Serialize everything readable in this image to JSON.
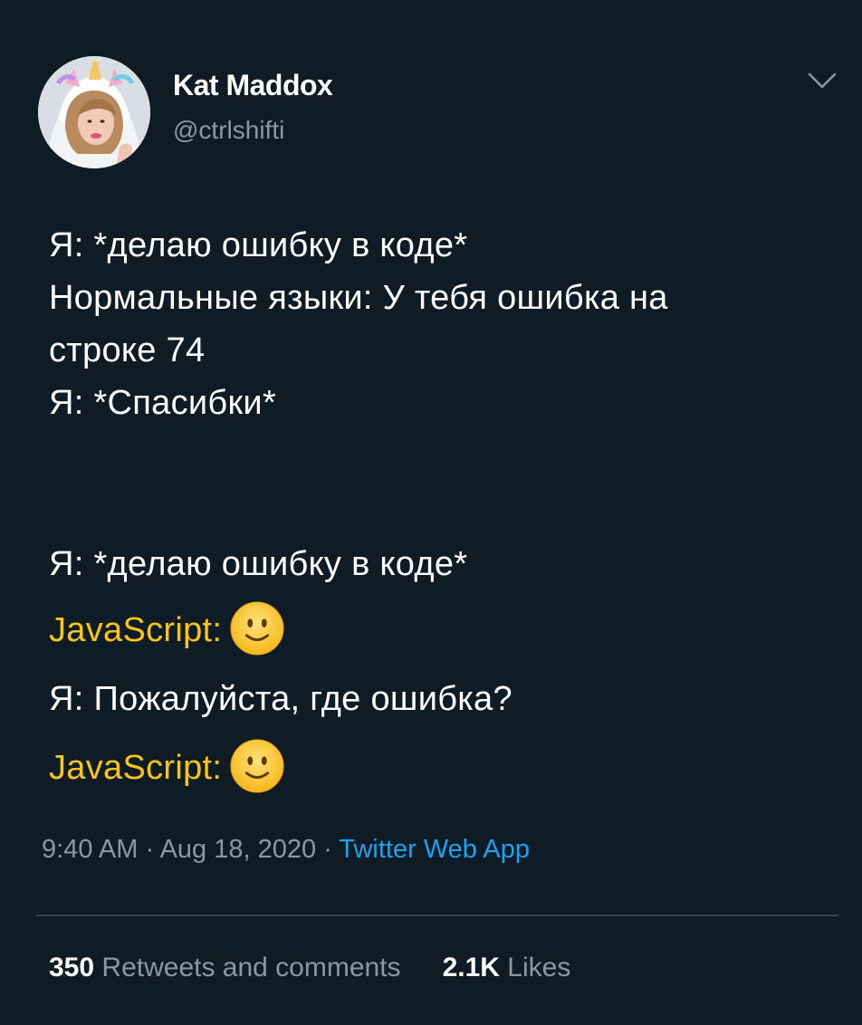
{
  "author": {
    "name": "Kat Maddox",
    "handle": "@ctrlshifti"
  },
  "icons": {
    "menu": "chevron-down-icon",
    "emoji": "slightly-smiling-face-icon"
  },
  "colors": {
    "background": "#0f1c26",
    "text": "#ffffff",
    "muted": "#8899a6",
    "link": "#1da1f2",
    "highlight": "#f5c518"
  },
  "tweet": {
    "block1": [
      "Я: *делаю ошибку в коде*",
      "Нормальные языки: У тебя ошибка на",
      "строке 74",
      "Я: *Спасибки*"
    ],
    "block2": {
      "line1": "Я: *делаю ошибку в коде*",
      "js_label_1": "JavaScript:",
      "line3": "Я: Пожалуйста, где ошибка?",
      "js_label_2": "JavaScript:"
    }
  },
  "meta": {
    "time": "9:40 AM",
    "sep1": " · ",
    "date": "Aug 18, 2020",
    "sep2": " · ",
    "source": "Twitter Web App"
  },
  "stats": {
    "retweets_count": "350",
    "retweets_label": "Retweets and comments",
    "likes_count": "2.1K",
    "likes_label": "Likes"
  }
}
